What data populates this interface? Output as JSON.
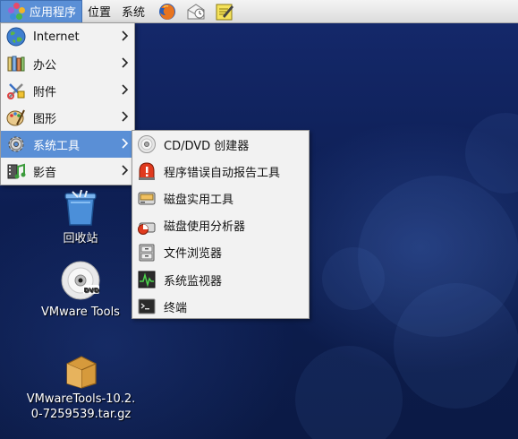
{
  "panel": {
    "menus": [
      {
        "label": "应用程序",
        "active": true
      },
      {
        "label": "位置",
        "active": false
      },
      {
        "label": "系统",
        "active": false
      }
    ],
    "launchers": [
      "firefox-icon",
      "mail-icon",
      "note-editor-icon"
    ]
  },
  "applications_menu": {
    "items": [
      {
        "label": "Internet",
        "icon": "globe-icon"
      },
      {
        "label": "办公",
        "icon": "office-icon"
      },
      {
        "label": "附件",
        "icon": "accessories-icon"
      },
      {
        "label": "图形",
        "icon": "graphics-icon"
      },
      {
        "label": "系统工具",
        "icon": "gear-icon",
        "highlighted": true
      },
      {
        "label": "影音",
        "icon": "multimedia-icon"
      }
    ]
  },
  "system_tools_submenu": {
    "items": [
      {
        "label": "CD/DVD 创建器",
        "icon": "cd-icon"
      },
      {
        "label": "程序错误自动报告工具",
        "icon": "alert-icon"
      },
      {
        "label": "磁盘实用工具",
        "icon": "disk-icon"
      },
      {
        "label": "磁盘使用分析器",
        "icon": "disk-usage-icon"
      },
      {
        "label": "文件浏览器",
        "icon": "file-browser-icon"
      },
      {
        "label": "系统监视器",
        "icon": "system-monitor-icon"
      },
      {
        "label": "终端",
        "icon": "terminal-icon"
      }
    ]
  },
  "desktop": {
    "icons": [
      {
        "label": "回收站",
        "icon": "trash-icon"
      },
      {
        "label": "VMware Tools",
        "icon": "dvd-icon"
      },
      {
        "label_line1": "VMwareTools-10.2.",
        "label_line2": "0-7259539.tar.gz",
        "icon": "archive-icon"
      }
    ]
  },
  "colors": {
    "highlight": "#5a8fd6",
    "desktop": "#0d1e52"
  }
}
